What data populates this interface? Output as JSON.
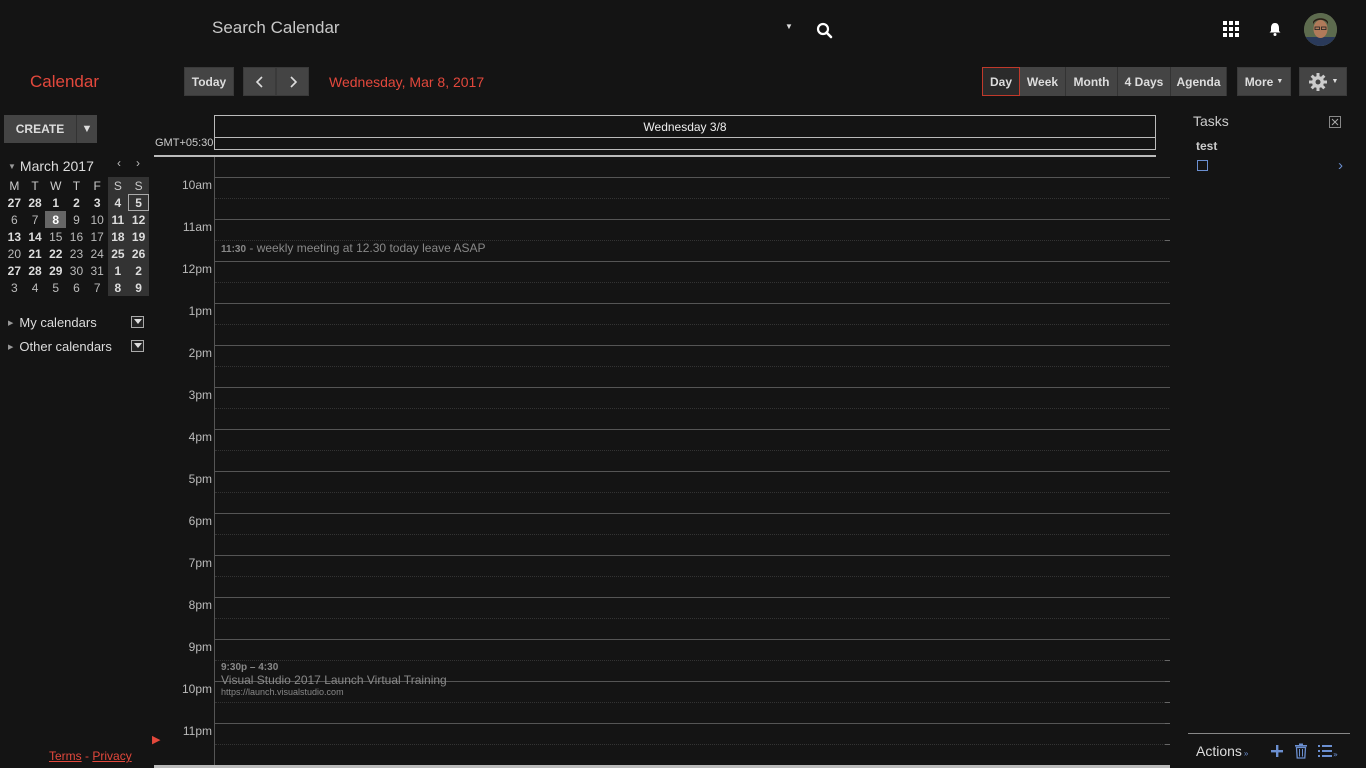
{
  "header": {
    "search_label": "Search Calendar",
    "search_icon": "search-icon",
    "apps_icon": "apps-grid-icon",
    "notifications_icon": "bell-icon"
  },
  "toolbar": {
    "app_title": "Calendar",
    "today_label": "Today",
    "current_date": "Wednesday, Mar 8, 2017",
    "views": [
      {
        "label": "Day",
        "active": true
      },
      {
        "label": "Week",
        "active": false
      },
      {
        "label": "Month",
        "active": false
      },
      {
        "label": "4 Days",
        "active": false
      },
      {
        "label": "Agenda",
        "active": false
      }
    ],
    "more_label": "More",
    "settings_icon": "gear-icon"
  },
  "sidebar": {
    "create_label": "CREATE",
    "mini_calendar": {
      "month_label": "March 2017",
      "weekdays": [
        "M",
        "T",
        "W",
        "T",
        "F",
        "S",
        "S"
      ],
      "weeks": [
        [
          "27",
          "28",
          "1",
          "2",
          "3",
          "4",
          "5"
        ],
        [
          "6",
          "7",
          "8",
          "9",
          "10",
          "11",
          "12"
        ],
        [
          "13",
          "14",
          "15",
          "16",
          "17",
          "18",
          "19"
        ],
        [
          "20",
          "21",
          "22",
          "23",
          "24",
          "25",
          "26"
        ],
        [
          "27",
          "28",
          "29",
          "30",
          "31",
          "1",
          "2"
        ],
        [
          "3",
          "4",
          "5",
          "6",
          "7",
          "8",
          "9"
        ]
      ],
      "today": "8"
    },
    "my_calendars_label": "My calendars",
    "other_calendars_label": "Other calendars",
    "terms_label": "Terms",
    "footer_sep": "-",
    "privacy_label": "Privacy"
  },
  "day_view": {
    "timezone_label": "GMT+05:30",
    "day_header": "Wednesday 3/8",
    "hours": [
      "10am",
      "11am",
      "12pm",
      "1pm",
      "2pm",
      "3pm",
      "4pm",
      "5pm",
      "6pm",
      "7pm",
      "8pm",
      "9pm",
      "10pm",
      "11pm"
    ],
    "events": [
      {
        "time": "11:30",
        "title": " - weekly meeting at 12.30 today leave ASAP"
      },
      {
        "time": "9:30p – 4:30",
        "title": "Visual Studio 2017 Launch Virtual Training",
        "location": "https://launch.visualstudio.com"
      }
    ]
  },
  "tasks": {
    "title": "Tasks",
    "list_name": "test",
    "actions_label": "Actions"
  }
}
